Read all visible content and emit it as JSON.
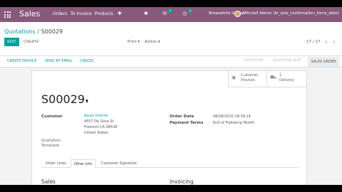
{
  "topbar": {
    "apps_icon": "apps-grid-icon",
    "app_title": "Sales",
    "menu": [
      "Orders",
      "To Invoice",
      "Products"
    ],
    "plus_icon": "plus-icon",
    "bug_icon": "bug-icon",
    "chat_icon": "chat-icon",
    "chat_badge": "7",
    "clock_icon": "clock-icon",
    "clock_badge": "5",
    "company": "BrowseInfo Global",
    "user": "Mitchell Admin (bi_sale_confirmation_force_date)"
  },
  "control": {
    "breadcrumb_parent": "Quotations",
    "breadcrumb_sep": "/",
    "breadcrumb_current": "S00029",
    "edit_label": "EDIT",
    "create_label": "CREATE",
    "print_label": "Print ▾",
    "action_label": "Action ▾",
    "pager": "17 / 17",
    "prev_icon": "‹",
    "next_icon": "›"
  },
  "statusbar": {
    "create_invoice": "CREATE INVOICE",
    "send_email": "SEND BY EMAIL",
    "cancel": "CANCEL",
    "stages": [
      "QUOTATION",
      "QUOTATION SENT",
      "SALES ORDER"
    ]
  },
  "sheet": {
    "smart_preview_l1": "Customer",
    "smart_preview_l2": "Preview",
    "smart_preview_icon": "globe-icon",
    "smart_delivery_l1": "1",
    "smart_delivery_l2": "Delivery",
    "smart_delivery_icon": "truck-icon",
    "title": "S00029",
    "customer_label": "Customer",
    "customer_name": "Azure Interior",
    "customer_addr1": "4557 De Silva St",
    "customer_addr2": "Fremont CA 94538",
    "customer_addr3": "United States",
    "template_label1": "Quotation",
    "template_label2": "Template",
    "order_date_label": "Order Date",
    "order_date": "08/28/2020 18:39:14",
    "payment_terms_label": "Payment Terms",
    "payment_terms": "End of Following Month",
    "tabs": [
      "Order Lines",
      "Other Info",
      "Customer Signature"
    ],
    "sales_heading": "Sales",
    "invoicing_heading": "Invoicing"
  }
}
